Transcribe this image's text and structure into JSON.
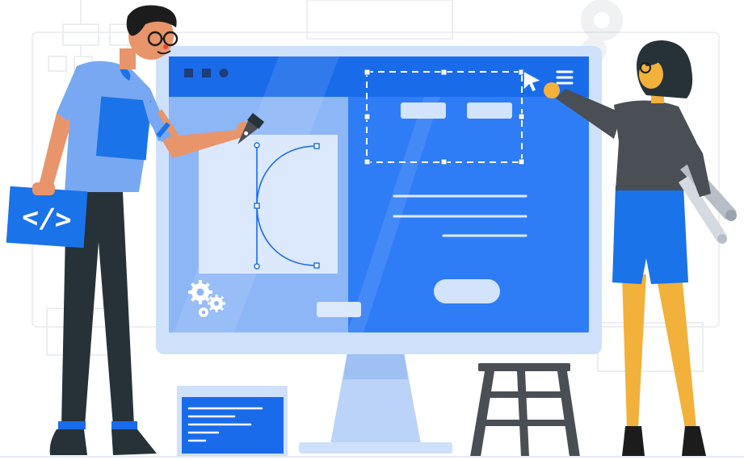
{
  "illustration": {
    "code_icon": "</>",
    "icons": [
      "code-brackets-icon",
      "gear-icon",
      "hamburger-menu-icon",
      "pen-tool-icon",
      "cursor-arrow-icon",
      "play-icon"
    ],
    "colors": {
      "primary": "#1A73E8",
      "screen": "#2F7DF6",
      "panel_light": "#8DB6F7",
      "frame": "#CFE0FB",
      "dark": "#263238",
      "skin": "#E8956B",
      "hair": "#1C1C1C",
      "gray_top": "#4A4E55",
      "leg": "#F2B13A"
    }
  }
}
